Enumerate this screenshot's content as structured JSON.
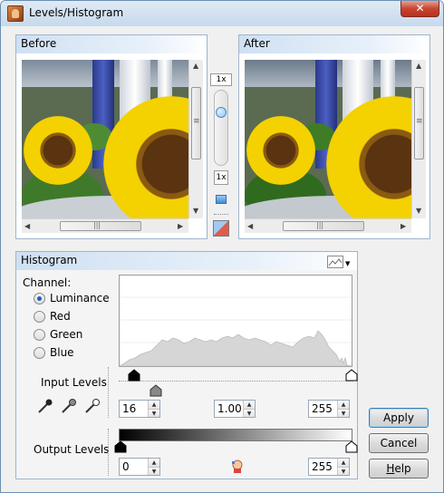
{
  "window": {
    "title": "Levels/Histogram",
    "close_glyph": "✕"
  },
  "before_panel": {
    "title": "Before"
  },
  "after_panel": {
    "title": "After"
  },
  "zoom": {
    "label": "1x",
    "reset_label": "1x"
  },
  "scroll": {
    "thumb_grip": "≡",
    "hthumb_grip": "|||"
  },
  "histogram_panel": {
    "title": "Histogram"
  },
  "channel": {
    "label": "Channel:",
    "options": [
      "Luminance",
      "Red",
      "Green",
      "Blue"
    ],
    "selected": "Luminance"
  },
  "input_levels": {
    "label": "Input Levels",
    "black": "16",
    "gamma": "1.00",
    "white": "255"
  },
  "output_levels": {
    "label": "Output Levels",
    "black": "0",
    "white": "255"
  },
  "buttons": {
    "apply": "Apply",
    "cancel": "Cancel",
    "help_prefix": "",
    "help_underlined": "H",
    "help_rest": "elp"
  },
  "colors": {
    "title_bar": "#c7d9ec",
    "close_button": "#c8452f",
    "header_gradient": "#cfe0f3",
    "histogram_fill": "#d6d6d6"
  },
  "icons": [
    "app-icon",
    "close-icon",
    "zoom-slider-icon",
    "fit-icon",
    "compare-icon",
    "histogram-mode-icon",
    "black-eyedropper-icon",
    "gray-eyedropper-icon",
    "white-eyedropper-icon",
    "auto-levels-icon"
  ]
}
